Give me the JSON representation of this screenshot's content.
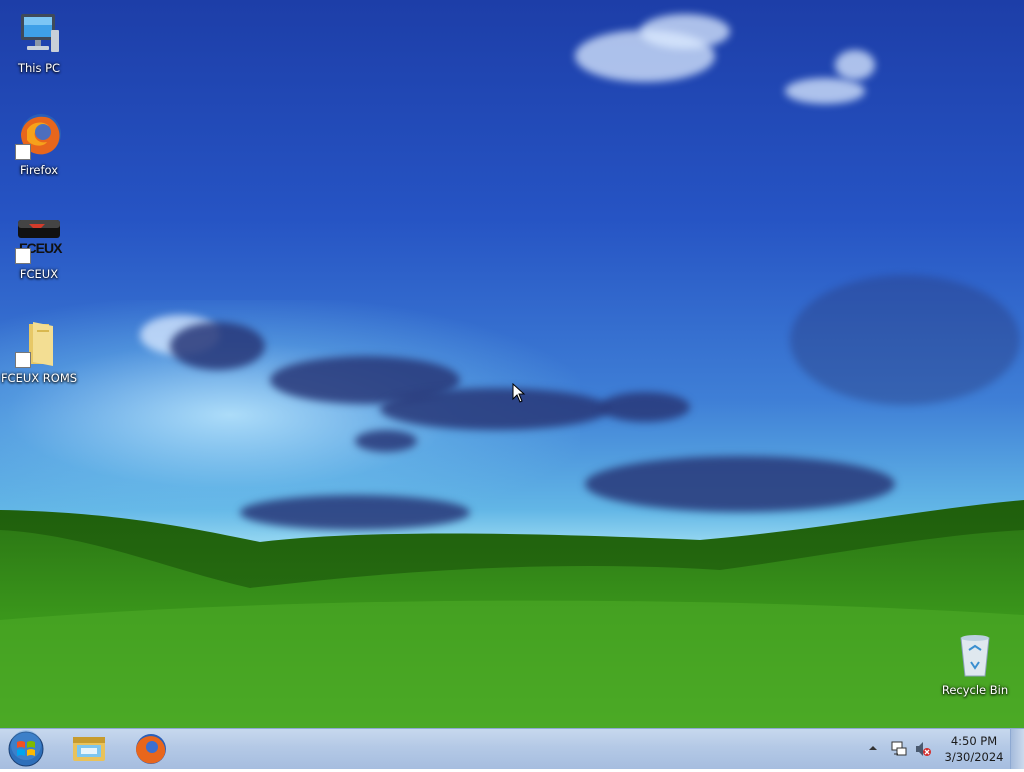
{
  "desktop": {
    "icons": [
      {
        "label": "This PC",
        "icon": "computer-icon"
      },
      {
        "label": "Firefox",
        "icon": "firefox-icon"
      },
      {
        "label": "FCEUX",
        "icon": "fceux-icon",
        "overlay_text": "FCEUX"
      },
      {
        "label": "FCEUX ROMS",
        "icon": "folder-icon"
      },
      {
        "label": "Recycle Bin",
        "icon": "recycle-bin-icon"
      }
    ]
  },
  "taskbar": {
    "start_button": "windows-start-icon",
    "pinned": [
      {
        "name": "File Explorer",
        "icon": "file-explorer-icon"
      },
      {
        "name": "Firefox",
        "icon": "firefox-icon"
      }
    ],
    "tray": {
      "icons": [
        "show-hidden-icons-icon",
        "network-icon",
        "volume-muted-icon"
      ]
    },
    "clock": {
      "time": "4:50 PM",
      "date": "3/30/2024"
    }
  },
  "colors": {
    "taskbar": "#b4c9e6",
    "sky_top": "#1d3ea8",
    "grass": "#3f9b1c",
    "firefox_orange": "#e8661c"
  }
}
